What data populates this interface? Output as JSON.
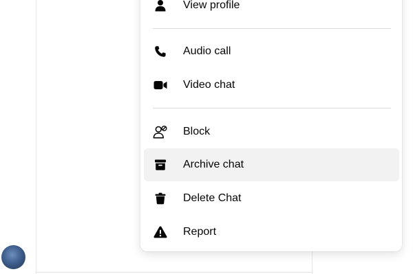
{
  "menu": {
    "items": [
      {
        "label": "View profile",
        "icon": "person-icon"
      },
      {
        "label": "Audio call",
        "icon": "phone-icon"
      },
      {
        "label": "Video chat",
        "icon": "video-camera-icon"
      },
      {
        "label": "Block",
        "icon": "block-user-icon"
      },
      {
        "label": "Archive chat",
        "icon": "archive-box-icon",
        "highlighted": true
      },
      {
        "label": "Delete Chat",
        "icon": "trash-icon"
      },
      {
        "label": "Report",
        "icon": "warning-icon"
      }
    ]
  },
  "colors": {
    "text": "#050505",
    "hover_background": "#f2f2f2",
    "divider": "#dcdde0"
  }
}
